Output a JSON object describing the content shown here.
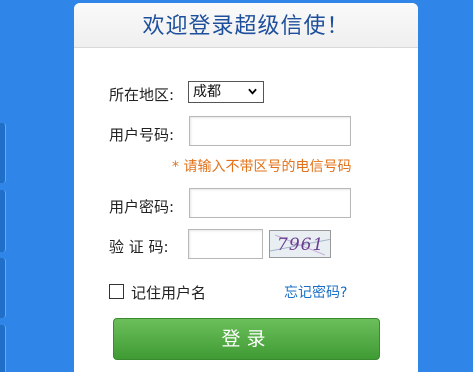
{
  "header": {
    "title": "欢迎登录超级信使！"
  },
  "form": {
    "region_label": "所在地区:",
    "region_selected": "成都",
    "user_label": "用户号码:",
    "user_value": "",
    "hint": "* 请输入不带区号的电信号码",
    "password_label": "用户密码:",
    "password_value": "",
    "captcha_label": "验 证 码:",
    "captcha_value": "",
    "captcha_image_text": "7961"
  },
  "remember": {
    "label": "记住用户名",
    "checked": false
  },
  "forgot_link": "忘记密码?",
  "login_button": "登录",
  "colors": {
    "background": "#2f86e8",
    "title": "#1e4f9c",
    "hint": "#e3721a",
    "link": "#1a6fc4",
    "button": "#4fa843"
  }
}
